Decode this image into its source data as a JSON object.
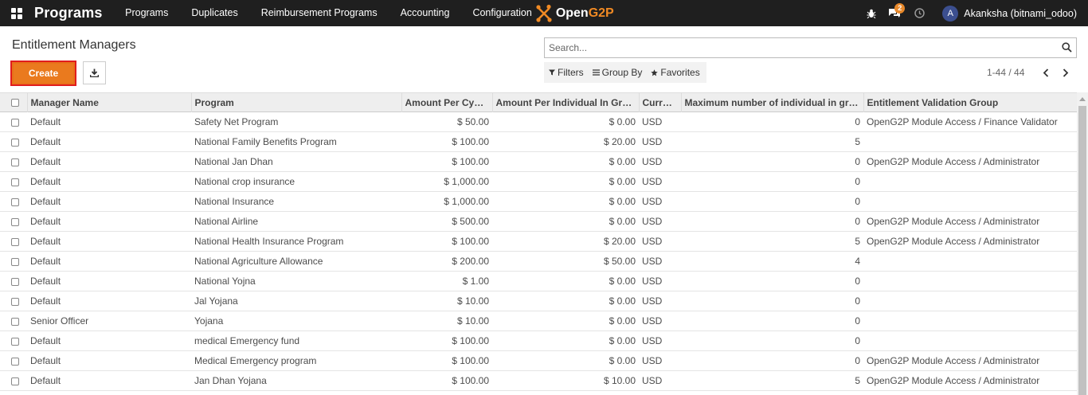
{
  "navbar": {
    "brand": "Programs",
    "menu": [
      "Programs",
      "Duplicates",
      "Reimbursement Programs",
      "Accounting",
      "Configuration"
    ],
    "logo_open": "Open",
    "logo_g2p": "G2P",
    "chat_count": "2",
    "avatar_letter": "A",
    "username": "Akanksha (bitnami_odoo)"
  },
  "control": {
    "title": "Entitlement Managers",
    "create_label": "Create",
    "search_placeholder": "Search...",
    "filters_label": "Filters",
    "groupby_label": "Group By",
    "favorites_label": "Favorites",
    "pager": "1-44 / 44"
  },
  "table": {
    "columns": [
      "Manager Name",
      "Program",
      "Amount Per Cycle...",
      "Amount Per Individual In Group",
      "Curren...",
      "Maximum number of individual in group",
      "Entitlement Validation Group"
    ],
    "rows": [
      [
        "Default",
        "Safety Net Program",
        "$ 50.00",
        "$ 0.00",
        "USD",
        "0",
        "OpenG2P Module Access / Finance Validator"
      ],
      [
        "Default",
        "National Family Benefits Program",
        "$ 100.00",
        "$ 20.00",
        "USD",
        "5",
        ""
      ],
      [
        "Default",
        "National Jan Dhan",
        "$ 100.00",
        "$ 0.00",
        "USD",
        "0",
        "OpenG2P Module Access / Administrator"
      ],
      [
        "Default",
        "National crop insurance",
        "$ 1,000.00",
        "$ 0.00",
        "USD",
        "0",
        ""
      ],
      [
        "Default",
        "National Insurance",
        "$ 1,000.00",
        "$ 0.00",
        "USD",
        "0",
        ""
      ],
      [
        "Default",
        "National Airline",
        "$ 500.00",
        "$ 0.00",
        "USD",
        "0",
        "OpenG2P Module Access / Administrator"
      ],
      [
        "Default",
        "National Health Insurance Program",
        "$ 100.00",
        "$ 20.00",
        "USD",
        "5",
        "OpenG2P Module Access / Administrator"
      ],
      [
        "Default",
        "National Agriculture Allowance",
        "$ 200.00",
        "$ 50.00",
        "USD",
        "4",
        ""
      ],
      [
        "Default",
        "National Yojna",
        "$ 1.00",
        "$ 0.00",
        "USD",
        "0",
        ""
      ],
      [
        "Default",
        "Jal Yojana",
        "$ 10.00",
        "$ 0.00",
        "USD",
        "0",
        ""
      ],
      [
        "Senior Officer",
        "Yojana",
        "$ 10.00",
        "$ 0.00",
        "USD",
        "0",
        ""
      ],
      [
        "Default",
        "medical Emergency fund",
        "$ 100.00",
        "$ 0.00",
        "USD",
        "0",
        ""
      ],
      [
        "Default",
        "Medical Emergency program",
        "$ 100.00",
        "$ 0.00",
        "USD",
        "0",
        "OpenG2P Module Access / Administrator"
      ],
      [
        "Default",
        "Jan Dhan Yojana",
        "$ 100.00",
        "$ 10.00",
        "USD",
        "5",
        "OpenG2P Module Access / Administrator"
      ]
    ]
  }
}
